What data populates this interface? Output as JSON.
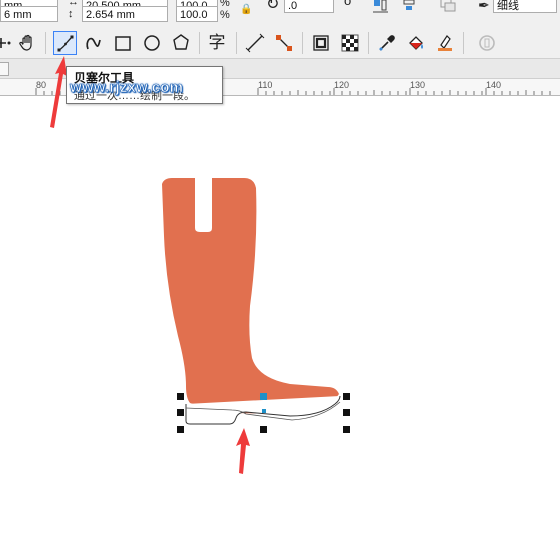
{
  "property_bar": {
    "pos_x_value": "mm",
    "pos_y_value": "6 mm",
    "width_value": "20.500 mm",
    "height_value": "2.654 mm",
    "scale_x_value": "100.0",
    "scale_y_value": "100.0",
    "scale_unit": "%",
    "rotation_value": ".0",
    "outline_width_value": "细线"
  },
  "tooltip": {
    "title": "贝塞尔工具",
    "description": "通过一次……绘制一段。"
  },
  "watermark": "www.rjzxw.com",
  "ruler": {
    "labels": [
      "80",
      "110",
      "120",
      "130",
      "140"
    ]
  },
  "colors": {
    "boot_fill": "#e1704f",
    "selection_node": "#1e90c8",
    "arrow": "#ee3b3b",
    "active_tool_border": "#3b82f6"
  },
  "tools": [
    "pan-tool-icon",
    "bezier-tool-icon",
    "artistic-media-icon",
    "rectangle-tool-icon",
    "ellipse-tool-icon",
    "polygon-tool-icon",
    "text-tool-icon",
    "parallel-dimension-icon",
    "connector-tool-icon",
    "drop-shadow-icon",
    "transparency-icon",
    "eyedropper-icon",
    "interactive-fill-icon",
    "smart-fill-icon",
    "outline-icon"
  ]
}
